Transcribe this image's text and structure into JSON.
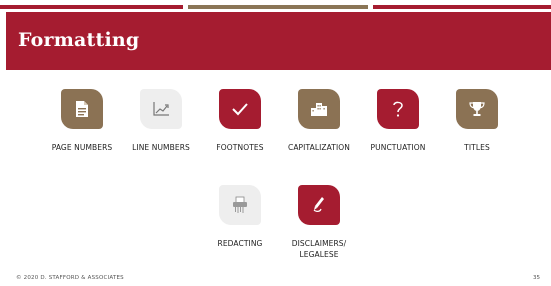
{
  "slide": {
    "title": "Formatting",
    "footer": "© 2020 D. STAFFORD & ASSOCIATES",
    "page_number": "35"
  },
  "colors": {
    "crimson": "#a51c30",
    "bronze": "#8b7254",
    "light_tile": "#eeeeee"
  },
  "items": [
    {
      "label": "PAGE NUMBERS",
      "icon": "document-icon"
    },
    {
      "label": "LINE NUMBERS",
      "icon": "line-chart-icon"
    },
    {
      "label": "FOOTNOTES",
      "icon": "checkmark-icon"
    },
    {
      "label": "CAPITALIZATION",
      "icon": "buildings-icon"
    },
    {
      "label": "PUNCTUATION",
      "icon": "question-mark-icon"
    },
    {
      "label": "TITLES",
      "icon": "trophy-icon"
    },
    {
      "label": "REDACTING",
      "icon": "shredder-icon"
    },
    {
      "label_line1": "DISCLAIMERS/",
      "label_line2": "LEGALESE",
      "icon": "hand-pen-icon"
    }
  ]
}
